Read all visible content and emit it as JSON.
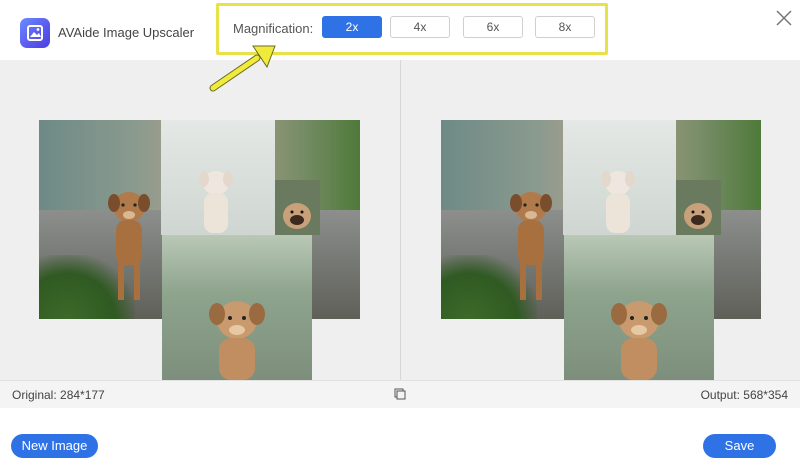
{
  "app": {
    "title": "AVAide Image Upscaler"
  },
  "magnification": {
    "label": "Magnification:",
    "options": [
      "2x",
      "4x",
      "6x",
      "8x"
    ],
    "selected": "2x"
  },
  "info": {
    "original": "Original: 284*177",
    "output": "Output: 568*354"
  },
  "footer": {
    "new_image_label": "New Image",
    "save_label": "Save"
  },
  "colors": {
    "accent": "#2f72e6",
    "highlight": "#e7e24a",
    "arrow": "#f0ea3a"
  },
  "icons": {
    "close": "close-icon",
    "compare": "compare-icon",
    "logo": "app-logo-icon"
  }
}
